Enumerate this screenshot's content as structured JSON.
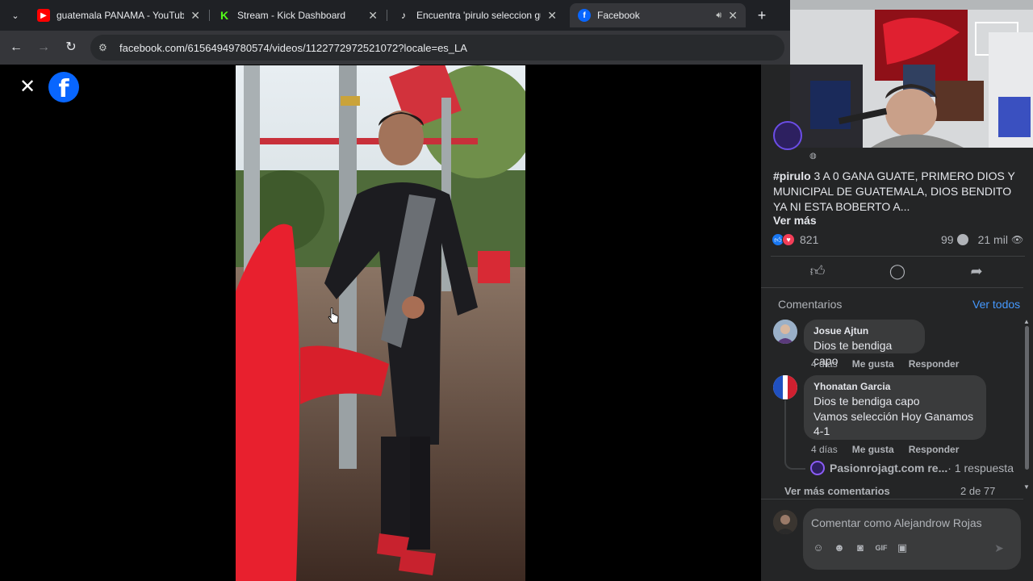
{
  "browser": {
    "tabs": [
      {
        "title": "guatemala PANAMA - YouTube",
        "icon": "youtube-icon"
      },
      {
        "title": "Stream - Kick Dashboard",
        "icon": "kick-icon"
      },
      {
        "title": "Encuentra 'pirulo seleccion guatemala'",
        "icon": "tiktok-icon"
      },
      {
        "title": "Facebook",
        "icon": "facebook-icon",
        "active": true
      }
    ],
    "new_tab": "+",
    "url": "facebook.com/61564949780574/videos/1122772972521072?locale=es_LA"
  },
  "viewer": {
    "close": "✕",
    "logo": "f"
  },
  "post": {
    "hashtag": "#pirulo",
    "text": " 3 A 0 GANA GUATE, PRIMERO DIOS Y MUNICIPAL DE GUATEMALA, DIOS BENDITO YA NI ESTA BOBERTO A...",
    "see_more": "Ver más",
    "reactions_count": "821",
    "comments_count": "99",
    "views": "21 mil"
  },
  "comments": {
    "title": "Comentarios",
    "see_all": "Ver todos",
    "items": [
      {
        "name": "Josue Ajtun",
        "lines": [
          "Dios te bendiga capo"
        ],
        "time": "4 días",
        "like": "Me gusta",
        "reply": "Responder"
      },
      {
        "name": "Yhonatan Garcia",
        "lines": [
          "Dios te bendiga capo",
          "Vamos selección Hoy Ganamos",
          "4-1"
        ],
        "time": "4 días",
        "like": "Me gusta",
        "reply": "Responder"
      }
    ],
    "reply_author": "Pasionrojagt.com re...",
    "reply_count": " · 1 respuesta",
    "more_comments": "Ver más comentarios",
    "page_count": "2 de 77"
  },
  "composer": {
    "placeholder": "Comentar como Alejandrow Rojas"
  },
  "colors": {
    "accent": "#0866ff",
    "link": "#4599ff",
    "panel": "#242526"
  }
}
